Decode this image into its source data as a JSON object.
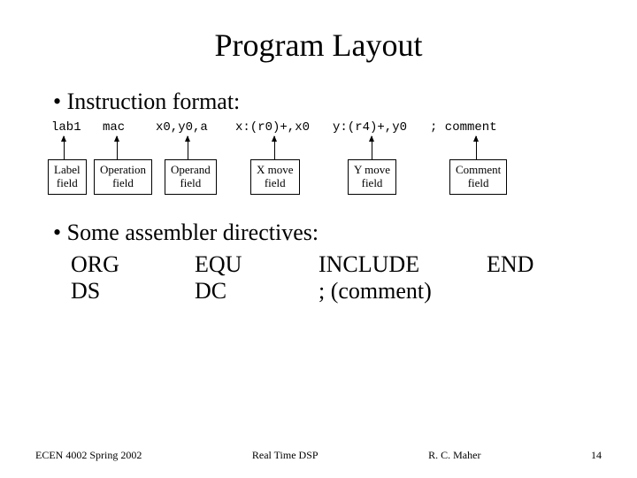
{
  "title": "Program Layout",
  "bullet1": "Instruction format:",
  "instruction": {
    "label": "lab1",
    "op": "mac",
    "operand": "x0,y0,a",
    "xmove": "x:(r0)+,x0",
    "ymove": "y:(r4)+,y0",
    "comment": "; comment"
  },
  "boxes": {
    "label": "Label\nfield",
    "op": "Operation\nfield",
    "operand": "Operand\nfield",
    "xmove": "X move\nfield",
    "ymove": "Y move\nfield",
    "comment": "Comment\nfield"
  },
  "bullet2": "Some assembler directives:",
  "directives": {
    "r1c1": "ORG",
    "r1c2": "EQU",
    "r1c3": "INCLUDE",
    "r1c4": "END",
    "r2c1": "DS",
    "r2c2": "DC",
    "r2c3": ";  (comment)"
  },
  "footer": {
    "left": "ECEN 4002 Spring 2002",
    "center": "Real Time DSP",
    "right_author": "R. C. Maher",
    "page": "14"
  }
}
